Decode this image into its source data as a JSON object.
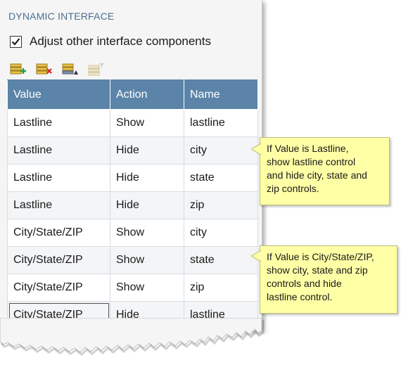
{
  "section": {
    "title": "DYNAMIC INTERFACE"
  },
  "adjust_checkbox": {
    "label": "Adjust other interface components",
    "checked": true
  },
  "toolbar": {
    "tools": [
      {
        "icon": "add-row-icon"
      },
      {
        "icon": "delete-row-icon"
      },
      {
        "icon": "sort-rows-icon"
      },
      {
        "icon": "filter-rows-icon"
      }
    ]
  },
  "table": {
    "columns": [
      "Value",
      "Action",
      "Name"
    ],
    "rows": [
      {
        "value": "Lastline",
        "action": "Show",
        "name": "lastline"
      },
      {
        "value": "Lastline",
        "action": "Hide",
        "name": "city"
      },
      {
        "value": "Lastline",
        "action": "Hide",
        "name": "state"
      },
      {
        "value": "Lastline",
        "action": "Hide",
        "name": "zip"
      },
      {
        "value": "City/State/ZIP",
        "action": "Show",
        "name": "city"
      },
      {
        "value": "City/State/ZIP",
        "action": "Show",
        "name": "state"
      },
      {
        "value": "City/State/ZIP",
        "action": "Show",
        "name": "zip"
      },
      {
        "value": "City/State/ZIP",
        "action": "Hide",
        "name": "lastline"
      }
    ]
  },
  "notes": [
    {
      "lines": [
        "If Value is Lastline,",
        "show lastline control",
        "and hide city, state and",
        "zip controls."
      ]
    },
    {
      "lines": [
        "If Value is City/State/ZIP,",
        "show city, state and zip",
        "controls and hide",
        "lastline control."
      ]
    }
  ],
  "colors": {
    "header_bg": "#5b84a8",
    "title_text": "#4a6f8e",
    "note_bg": "#ffffa6"
  }
}
